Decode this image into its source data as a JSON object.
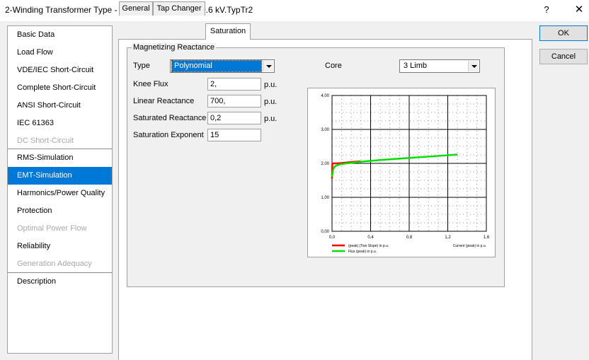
{
  "window": {
    "title": "2-Winding Transformer Type - Library\\60MVA_210/10.6 kV.TypTr2",
    "help_label": "?",
    "close_label": "✕"
  },
  "sidebar": {
    "items": [
      {
        "label": "Basic Data",
        "disabled": false,
        "selected": false
      },
      {
        "label": "Load Flow",
        "disabled": false,
        "selected": false
      },
      {
        "label": "VDE/IEC Short-Circuit",
        "disabled": false,
        "selected": false
      },
      {
        "label": "Complete Short-Circuit",
        "disabled": false,
        "selected": false
      },
      {
        "label": "ANSI Short-Circuit",
        "disabled": false,
        "selected": false
      },
      {
        "label": "IEC 61363",
        "disabled": false,
        "selected": false
      },
      {
        "label": "DC Short-Circuit",
        "disabled": true,
        "selected": false
      },
      {
        "label": "RMS-Simulation",
        "disabled": false,
        "selected": false
      },
      {
        "label": "EMT-Simulation",
        "disabled": false,
        "selected": true
      },
      {
        "label": "Harmonics/Power Quality",
        "disabled": false,
        "selected": false
      },
      {
        "label": "Protection",
        "disabled": false,
        "selected": false
      },
      {
        "label": "Optimal Power Flow",
        "disabled": true,
        "selected": false
      },
      {
        "label": "Reliability",
        "disabled": false,
        "selected": false
      },
      {
        "label": "Generation Adequacy",
        "disabled": true,
        "selected": false
      },
      {
        "label": "Description",
        "disabled": false,
        "selected": false
      }
    ]
  },
  "tabs": [
    {
      "label": "General",
      "active": false
    },
    {
      "label": "Tap Changer",
      "active": false
    },
    {
      "label": "Saturation",
      "active": true
    }
  ],
  "group": {
    "legend": "Magnetizing Reactance"
  },
  "form": {
    "type_label": "Type",
    "type_value": "Polynomial",
    "core_label": "Core",
    "core_value": "3 Limb",
    "knee_flux_label": "Knee Flux",
    "knee_flux_value": "2,",
    "knee_flux_unit": "p.u.",
    "linear_reactance_label": "Linear Reactance",
    "linear_reactance_value": "700,",
    "linear_reactance_unit": "p.u.",
    "saturated_reactance_label": "Saturated Reactance",
    "saturated_reactance_value": "0,2",
    "saturated_reactance_unit": "p.u.",
    "saturation_exponent_label": "Saturation Exponent",
    "saturation_exponent_value": "15"
  },
  "buttons": {
    "ok": "OK",
    "cancel": "Cancel"
  },
  "chart_data": {
    "type": "line",
    "xlim": [
      0,
      1.6
    ],
    "ylim": [
      0,
      4
    ],
    "x_ticks": [
      {
        "v": 0.0,
        "label": "0,0"
      },
      {
        "v": 0.4,
        "label": "0,4"
      },
      {
        "v": 0.8,
        "label": "0,8"
      },
      {
        "v": 1.2,
        "label": "1,2"
      },
      {
        "v": 1.6,
        "label": "1,6"
      }
    ],
    "y_ticks": [
      {
        "v": 0.0,
        "label": "0,00"
      },
      {
        "v": 1.0,
        "label": "1,00"
      },
      {
        "v": 2.0,
        "label": "2,00"
      },
      {
        "v": 3.0,
        "label": "3,00"
      },
      {
        "v": 4.0,
        "label": "4,00"
      }
    ],
    "x_axis_label": "Current (peak) in p.u.",
    "grid": true,
    "legend_position": "bottom",
    "series": [
      {
        "name": "(peak) (Two Slope) in p.u.",
        "color": "#ff0000",
        "x": [
          0.0,
          0.003,
          0.05,
          0.1,
          0.2,
          0.3
        ],
        "y": [
          1.55,
          2.0,
          2.0,
          2.01,
          2.04,
          2.06
        ]
      },
      {
        "name": "Flux (peak) in p.u.",
        "color": "#00e000",
        "x": [
          0.0,
          0.005,
          0.01,
          0.02,
          0.04,
          0.08,
          0.15,
          0.3,
          0.5,
          0.7,
          0.9,
          1.1,
          1.3
        ],
        "y": [
          1.6,
          1.72,
          1.8,
          1.88,
          1.93,
          1.97,
          2.0,
          2.05,
          2.1,
          2.14,
          2.18,
          2.22,
          2.26
        ]
      }
    ]
  }
}
